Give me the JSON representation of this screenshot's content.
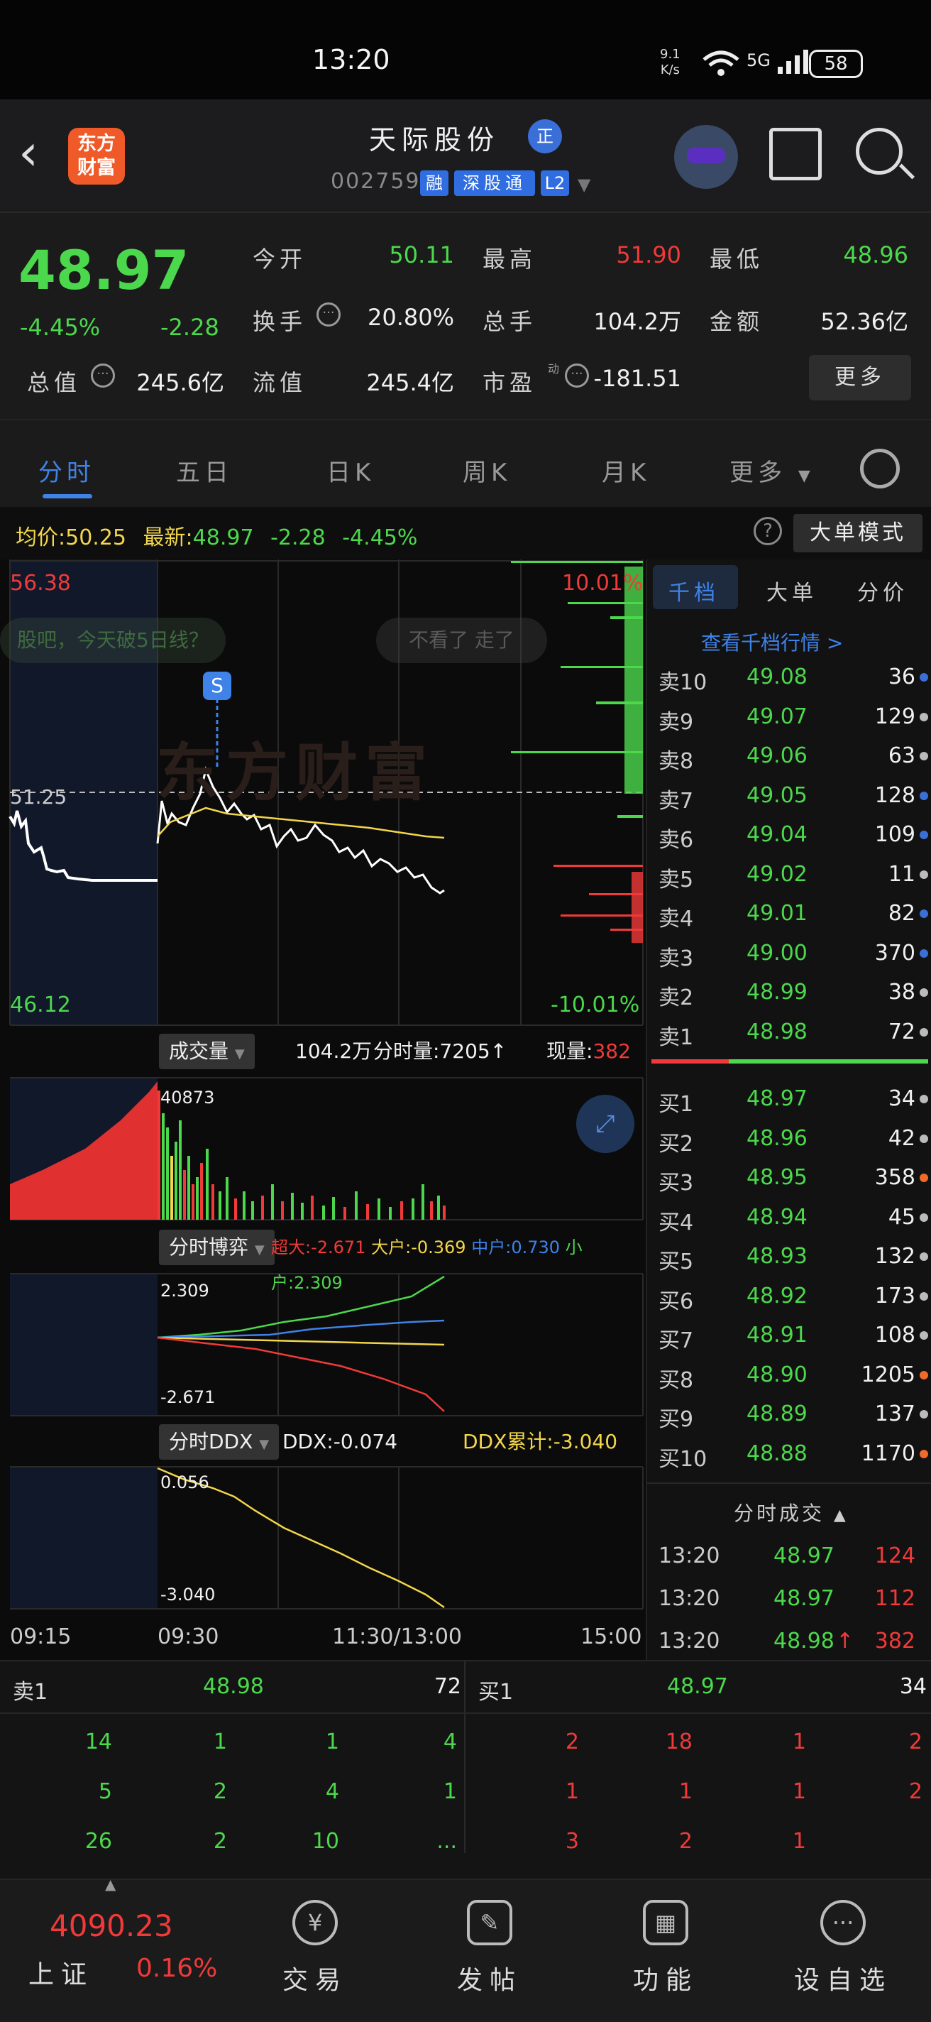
{
  "status_bar": {
    "time": "13:20",
    "net_speed": "9.1",
    "net_unit": "K/s",
    "signal": "5G",
    "battery": "58"
  },
  "header": {
    "stock_name": "天际股份",
    "name_badge": "正",
    "stock_code": "002759",
    "tags": [
      "融",
      "深股通",
      "L2"
    ],
    "logo_line1": "东方",
    "logo_line2": "财富"
  },
  "quote": {
    "price": "48.97",
    "change_pct": "-4.45%",
    "change": "-2.28",
    "open_label": "今开",
    "open": "50.11",
    "high_label": "最高",
    "high": "51.90",
    "low_label": "最低",
    "low": "48.96",
    "turnover_label": "换手",
    "turnover": "20.80%",
    "volume_label": "总手",
    "volume": "104.2万",
    "amount_label": "金额",
    "amount": "52.36亿",
    "mktcap_label": "总值",
    "mktcap": "245.6亿",
    "float_label": "流值",
    "float": "245.4亿",
    "pe_label": "市盈",
    "pe_sup": "动",
    "pe": "-181.51",
    "more_label": "更多"
  },
  "tabs": [
    "分时",
    "五日",
    "日K",
    "周K",
    "月K",
    "更多"
  ],
  "avg_bar": {
    "avg_label": "均价:",
    "avg": "50.25",
    "latest_label": "最新:",
    "latest": "48.97",
    "change": "-2.28",
    "change_pct": "-4.45%",
    "mode": "大单模式"
  },
  "price_chart": {
    "max": "56.38",
    "min": "46.12",
    "ref": "51.25",
    "max_pct": "10.01%",
    "min_pct": "-10.01%",
    "watermark": "东方财富",
    "comment1": "股吧，今天破5日线？",
    "comment2": "不看了 走了",
    "signal": "S"
  },
  "volume_panel": {
    "selector": "成交量",
    "total": "104.2万",
    "tick_label": "分时量:",
    "tick": "7205",
    "now_label": "现量:",
    "now": "382",
    "peak": "40873"
  },
  "game_panel": {
    "selector": "分时博弈",
    "super_label": "超大:",
    "super": "-2.671",
    "large_label": "大户:",
    "large": "-0.369",
    "mid_label": "中户:",
    "mid": "0.730",
    "small_label": "小户:",
    "small": "2.309",
    "top": "2.309",
    "bottom": "-2.671"
  },
  "ddx_panel": {
    "selector": "分时DDX",
    "ddx_label": "DDX:",
    "ddx": "-0.074",
    "cum_label": "DDX累计:",
    "cum": "-3.040",
    "top": "0.056",
    "bottom": "-3.040"
  },
  "time_axis": [
    "09:15",
    "09:30",
    "11:30/13:00",
    "15:00"
  ],
  "book": {
    "tabs": [
      "千档",
      "大单",
      "分价"
    ],
    "link": "查看千档行情 >",
    "asks": [
      {
        "label": "卖10",
        "price": "49.08",
        "vol": "36",
        "dot": "#3a6fd8"
      },
      {
        "label": "卖9",
        "price": "49.07",
        "vol": "129",
        "dot": "#bbbbbb"
      },
      {
        "label": "卖8",
        "price": "49.06",
        "vol": "63",
        "dot": "#bbbbbb"
      },
      {
        "label": "卖7",
        "price": "49.05",
        "vol": "128",
        "dot": "#3a6fd8"
      },
      {
        "label": "卖6",
        "price": "49.04",
        "vol": "109",
        "dot": "#3a6fd8"
      },
      {
        "label": "卖5",
        "price": "49.02",
        "vol": "11",
        "dot": "#bbbbbb"
      },
      {
        "label": "卖4",
        "price": "49.01",
        "vol": "82",
        "dot": "#3a6fd8"
      },
      {
        "label": "卖3",
        "price": "49.00",
        "vol": "370",
        "dot": "#3a6fd8"
      },
      {
        "label": "卖2",
        "price": "48.99",
        "vol": "38",
        "dot": "#bbbbbb"
      },
      {
        "label": "卖1",
        "price": "48.98",
        "vol": "72",
        "dot": "#bbbbbb"
      }
    ],
    "bids": [
      {
        "label": "买1",
        "price": "48.97",
        "vol": "34",
        "dot": "#bbbbbb"
      },
      {
        "label": "买2",
        "price": "48.96",
        "vol": "42",
        "dot": "#bbbbbb"
      },
      {
        "label": "买3",
        "price": "48.95",
        "vol": "358",
        "dot": "#f06a2a"
      },
      {
        "label": "买4",
        "price": "48.94",
        "vol": "45",
        "dot": "#bbbbbb"
      },
      {
        "label": "买5",
        "price": "48.93",
        "vol": "132",
        "dot": "#bbbbbb"
      },
      {
        "label": "买6",
        "price": "48.92",
        "vol": "173",
        "dot": "#bbbbbb"
      },
      {
        "label": "买7",
        "price": "48.91",
        "vol": "108",
        "dot": "#bbbbbb"
      },
      {
        "label": "买8",
        "price": "48.90",
        "vol": "1205",
        "dot": "#f06a2a"
      },
      {
        "label": "买9",
        "price": "48.89",
        "vol": "137",
        "dot": "#bbbbbb"
      },
      {
        "label": "买10",
        "price": "48.88",
        "vol": "1170",
        "dot": "#f06a2a"
      }
    ],
    "trades_title": "分时成交",
    "trades": [
      {
        "time": "13:20",
        "price": "48.97",
        "vol": "124",
        "arrow": ""
      },
      {
        "time": "13:20",
        "price": "48.97",
        "vol": "112",
        "arrow": ""
      },
      {
        "time": "13:20",
        "price": "48.98",
        "vol": "382",
        "arrow": "↑"
      }
    ]
  },
  "queue": {
    "ask_label": "卖1",
    "ask_price": "48.98",
    "ask_vol": "72",
    "bid_label": "买1",
    "bid_price": "48.97",
    "bid_vol": "34",
    "ask_rows": [
      [
        "14",
        "1",
        "1",
        "4"
      ],
      [
        "5",
        "2",
        "4",
        "1"
      ],
      [
        "26",
        "2",
        "10",
        "..."
      ]
    ],
    "bid_rows": [
      [
        "2",
        "18",
        "1",
        "2"
      ],
      [
        "1",
        "1",
        "1",
        "2"
      ],
      [
        "3",
        "2",
        "1",
        ""
      ]
    ]
  },
  "nav": {
    "index_value": "4090.23",
    "index_name": "上证",
    "index_pct": "0.16%",
    "items": [
      {
        "label": "交易",
        "icon": "¥"
      },
      {
        "label": "发帖",
        "icon": "✎"
      },
      {
        "label": "功能",
        "icon": "▦"
      },
      {
        "label": "设自选",
        "icon": "···"
      }
    ]
  },
  "colors": {
    "up": "#f03a3a",
    "down": "#4cd84c",
    "accent": "#3f82e8",
    "avg_line": "#f2d64b"
  }
}
